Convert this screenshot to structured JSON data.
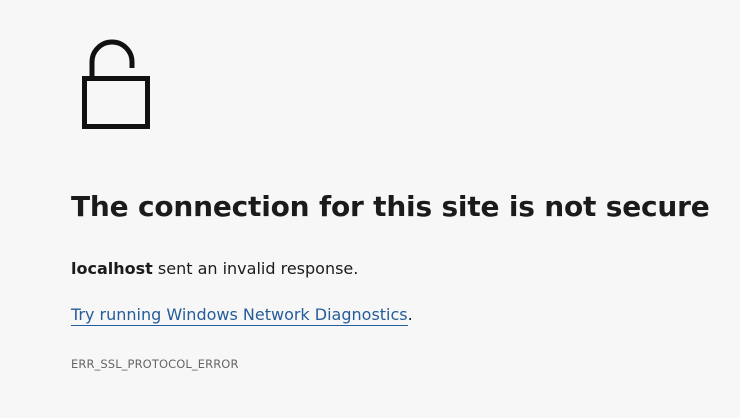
{
  "error_page": {
    "icon": "unlocked-padlock-icon",
    "headline": "The connection for this site is not secure",
    "host": "localhost",
    "description_suffix": " sent an invalid response.",
    "diagnostics_link": "Try running Windows Network Diagnostics",
    "diagnostics_suffix": ".",
    "error_code": "ERR_SSL_PROTOCOL_ERROR",
    "link_color": "#245d9a",
    "background_color": "#f7f7f7"
  }
}
